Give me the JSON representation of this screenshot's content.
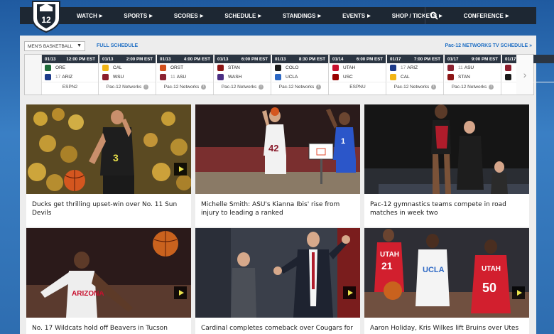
{
  "header": {
    "top_sliver": "…",
    "nav": [
      {
        "label": "WATCH"
      },
      {
        "label": "SPORTS"
      },
      {
        "label": "SCORES"
      },
      {
        "label": "SCHEDULE"
      },
      {
        "label": "STANDINGS"
      },
      {
        "label": "EVENTS"
      },
      {
        "label": "SHOP / TICKETS"
      },
      {
        "label": "CONFERENCE"
      }
    ],
    "search_icon": "search-icon",
    "logo_text": "12"
  },
  "schedule": {
    "sport_select": "MEN'S BASKETBALL",
    "full_schedule": "FULL SCHEDULE",
    "tv_schedule": "Pac-12 NETWORKS TV SCHEDULE »",
    "games": [
      {
        "date": "01/13",
        "time": "12:00 PM EST",
        "home": "ORE",
        "away_rank": "17",
        "away": "ARIZ",
        "network": "ESPN2",
        "home_color": "#1f6b3a",
        "away_color": "#1d3b8a"
      },
      {
        "date": "01/13",
        "time": "2:00 PM EST",
        "home": "CAL",
        "away_rank": "",
        "away": "WSU",
        "network": "Pac-12 Networks",
        "home_color": "#f2b515",
        "away_color": "#8c1d2c"
      },
      {
        "date": "01/13",
        "time": "4:00 PM EST",
        "home": "ORST",
        "away_rank": "11",
        "away": "ASU",
        "network": "Pac-12 Networks",
        "home_color": "#d3501c",
        "away_color": "#8c2332"
      },
      {
        "date": "01/13",
        "time": "6:00 PM EST",
        "home": "STAN",
        "away_rank": "",
        "away": "WASH",
        "network": "Pac-12 Networks",
        "home_color": "#8c1515",
        "away_color": "#4b2e83"
      },
      {
        "date": "01/13",
        "time": "8:30 PM EST",
        "home": "COLO",
        "away_rank": "",
        "away": "UCLA",
        "network": "Pac-12 Networks",
        "home_color": "#1a1a1a",
        "away_color": "#2d68c4"
      },
      {
        "date": "01/14",
        "time": "6:00 PM EST",
        "home": "UTAH",
        "away_rank": "",
        "away": "USC",
        "network": "ESPNU",
        "home_color": "#c8102e",
        "away_color": "#990000"
      },
      {
        "date": "01/17",
        "time": "7:00 PM EST",
        "home_rank": "17",
        "home": "ARIZ",
        "away_rank": "",
        "away": "CAL",
        "network": "Pac-12 Networks",
        "home_color": "#1d3b8a",
        "away_color": "#f2b515"
      },
      {
        "date": "01/17",
        "time": "9:00 PM EST",
        "home_rank": "11",
        "home": "ASU",
        "away_rank": "",
        "away": "STAN",
        "network": "Pac-12 Networks",
        "home_color": "#8c2332",
        "away_color": "#8c1515"
      },
      {
        "date": "01/17",
        "time": "",
        "home": "",
        "away_rank": "",
        "away": "",
        "network": "",
        "home_color": "#8c1d2c",
        "away_color": "#1a1a1a"
      }
    ]
  },
  "articles": [
    {
      "caption": "Ducks get thrilling upset-win over No. 11 Sun Devils",
      "video": true
    },
    {
      "caption": "Michelle Smith: ASU's Kianna Ibis' rise from injury to leading a ranked",
      "video": false
    },
    {
      "caption": "Pac-12 gymnastics teams compete in road matches in week two",
      "video": false
    },
    {
      "caption": "No. 17 Wildcats hold off Beavers in Tucson",
      "video": true
    },
    {
      "caption": "Cardinal completes comeback over Cougars for",
      "video": true
    },
    {
      "caption": "Aaron Holiday, Kris Wilkes lift Bruins over Utes",
      "video": true
    }
  ],
  "jersey_numbers": [
    "3",
    "42",
    "1",
    "21",
    "50"
  ],
  "jersey_text": [
    "ARIZONA",
    "UTAH",
    "UCLA",
    "UTAH"
  ]
}
